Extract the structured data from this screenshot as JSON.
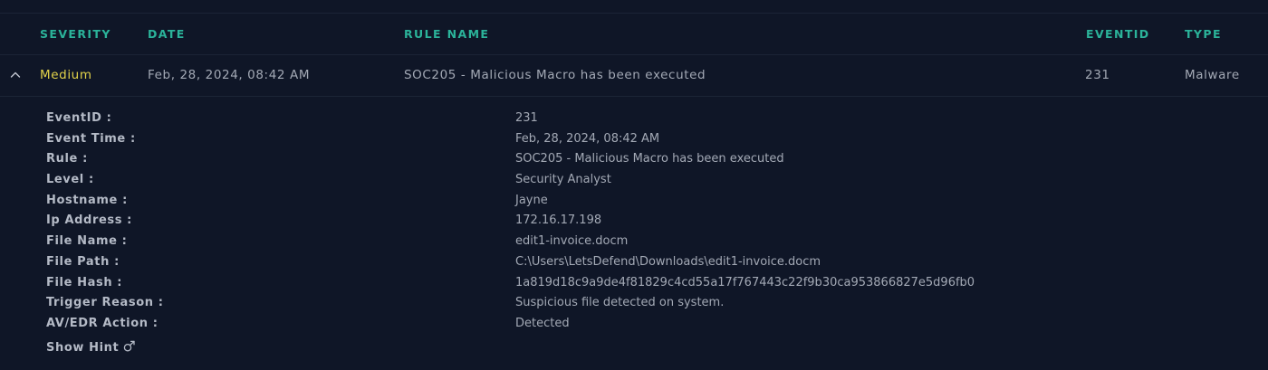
{
  "table": {
    "headers": {
      "severity": "SEVERITY",
      "date": "DATE",
      "rule_name": "RULE NAME",
      "eventid": "EVENTID",
      "type": "TYPE"
    },
    "row": {
      "severity": "Medium",
      "date": "Feb, 28, 2024, 08:42 AM",
      "rule_name": "SOC205 - Malicious Macro has been executed",
      "eventid": "231",
      "type": "Malware"
    }
  },
  "details": [
    {
      "label": "EventID :",
      "value": "231"
    },
    {
      "label": "Event Time :",
      "value": "Feb, 28, 2024, 08:42 AM"
    },
    {
      "label": "Rule :",
      "value": "SOC205 - Malicious Macro has been executed"
    },
    {
      "label": "Level :",
      "value": "Security Analyst"
    },
    {
      "label": "Hostname :",
      "value": "Jayne"
    },
    {
      "label": "Ip Address :",
      "value": "172.16.17.198"
    },
    {
      "label": "File Name :",
      "value": "edit1-invoice.docm"
    },
    {
      "label": "File Path :",
      "value": "C:\\Users\\LetsDefend\\Downloads\\edit1-invoice.docm"
    },
    {
      "label": "File Hash :",
      "value": "1a819d18c9a9de4f81829c4cd55a17f767443c22f9b30ca953866827e5d96fb0"
    },
    {
      "label": "Trigger Reason :",
      "value": "Suspicious file detected on system."
    },
    {
      "label": "AV/EDR Action :",
      "value": "Detected"
    }
  ],
  "hint": {
    "label": "Show Hint",
    "icon": "external-link-icon"
  },
  "colors": {
    "background": "#0f1627",
    "header_accent": "#2bb39a",
    "severity_medium": "#e3d34a",
    "text": "#a3a9b5"
  }
}
